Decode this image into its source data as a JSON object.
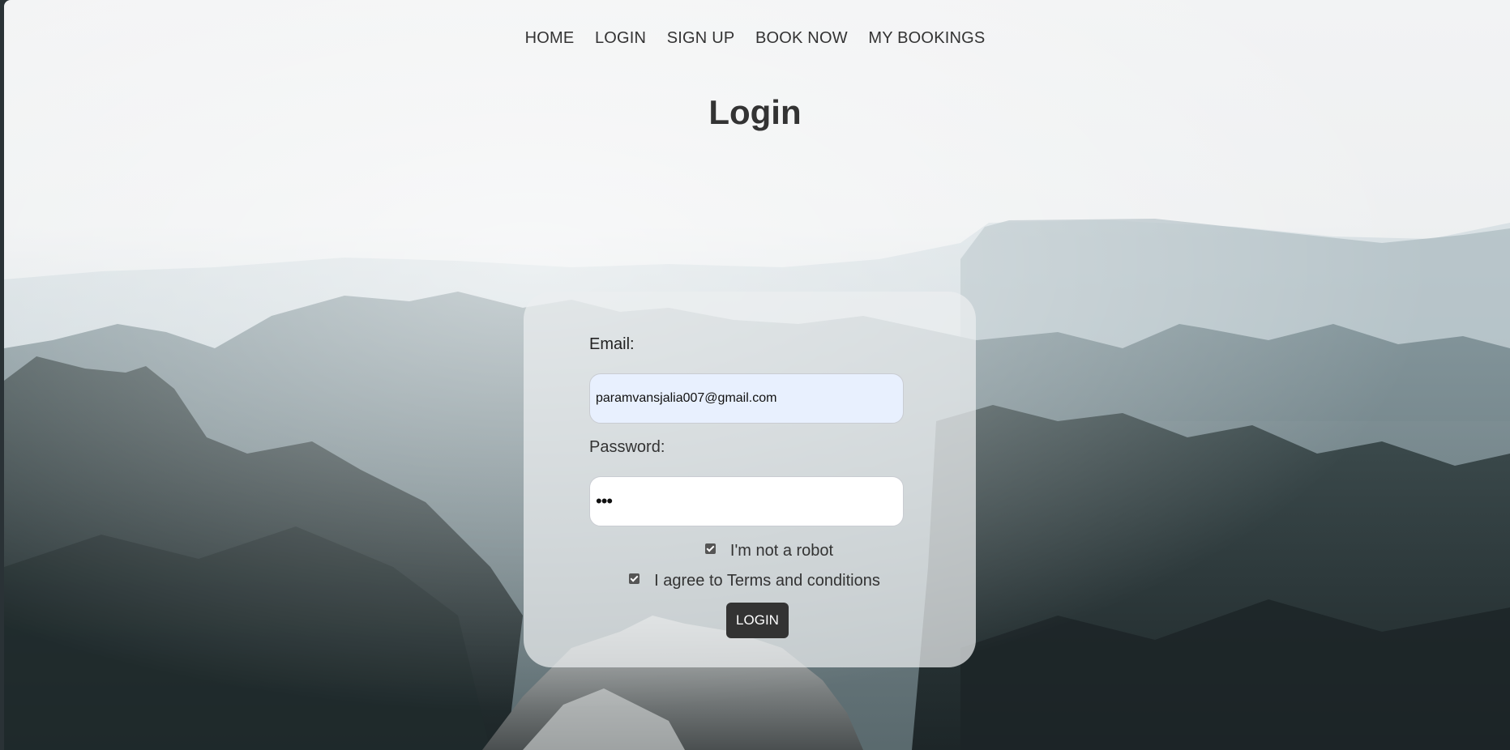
{
  "nav": {
    "items": [
      {
        "label": "HOME"
      },
      {
        "label": "LOGIN"
      },
      {
        "label": "SIGN UP"
      },
      {
        "label": "BOOK NOW"
      },
      {
        "label": "MY BOOKINGS"
      }
    ]
  },
  "page": {
    "title": "Login"
  },
  "form": {
    "email_label": "Email:",
    "email_value": "paramvansjalia007@gmail.com",
    "password_label": "Password:",
    "password_value": "abc",
    "robot_label": "I'm not a robot",
    "robot_checked": true,
    "terms_label": "I agree to Terms and conditions",
    "terms_checked": true,
    "submit_label": "LOGIN"
  },
  "colors": {
    "accent": "#333333",
    "email_autofill_bg": "#e8f0fe"
  }
}
